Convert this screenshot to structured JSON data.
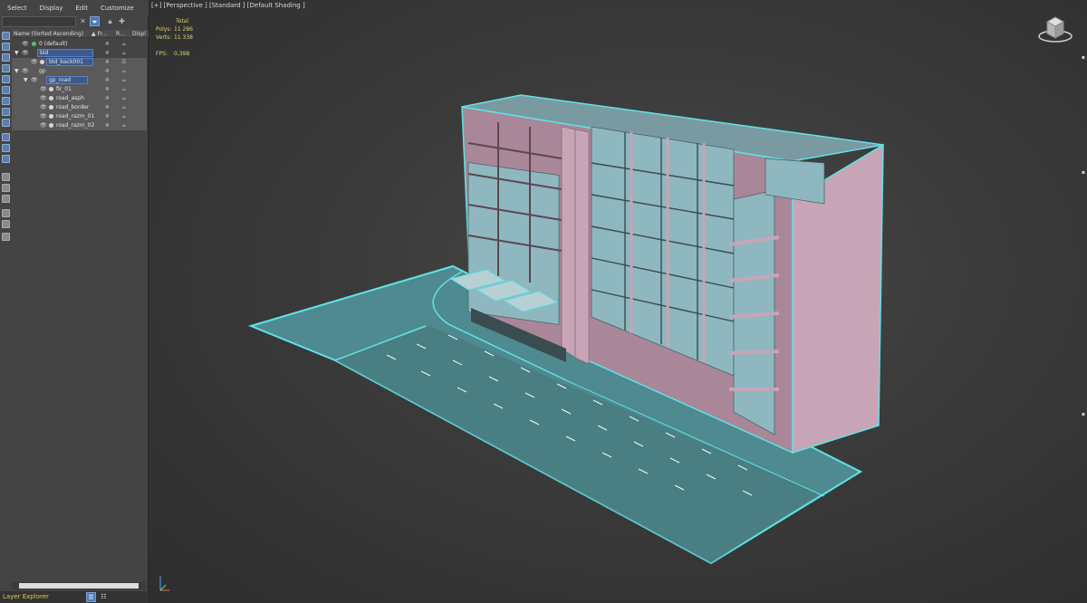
{
  "menu": [
    "Select",
    "Display",
    "Edit",
    "Customize"
  ],
  "explorer": {
    "columns": {
      "name": "Name (Sorted Ascending)",
      "frozen": "▲ Fr...",
      "render": "R...",
      "display": "Displ"
    },
    "rows": [
      {
        "label": "0 (default)",
        "depth": 1,
        "expandable": false
      },
      {
        "label": "bld",
        "depth": 0,
        "expandable": true
      },
      {
        "label": "bld_back001",
        "depth": 2,
        "expandable": false
      },
      {
        "label": "gp",
        "depth": 0,
        "expandable": true
      },
      {
        "label": "gp_road",
        "depth": 1,
        "expandable": true
      },
      {
        "label": "fir_01",
        "depth": 3,
        "expandable": false
      },
      {
        "label": "road_asph",
        "depth": 3,
        "expandable": false
      },
      {
        "label": "road_border",
        "depth": 3,
        "expandable": false
      },
      {
        "label": "road_razm_01",
        "depth": 3,
        "expandable": false
      },
      {
        "label": "road_razm_02",
        "depth": 3,
        "expandable": false
      }
    ],
    "footer_label": "Layer Explorer"
  },
  "viewport": {
    "label": "[+] [Perspective ] [Standard ] [Default Shading ]",
    "stats": {
      "header": "Total",
      "polys_label": "Polys:",
      "polys": "11 286",
      "verts_label": "Verts:",
      "verts": "11 338",
      "fps_label": "FPS:",
      "fps": "0,398"
    }
  },
  "colors": {
    "panel": "#444444",
    "selection": "#3d5a8f",
    "stats_text": "#e0d26e",
    "wire_highlight": "#5fe3e6",
    "building": "#c7a5b6",
    "glass": "#8fb7c0",
    "road": "#4e8a90"
  }
}
